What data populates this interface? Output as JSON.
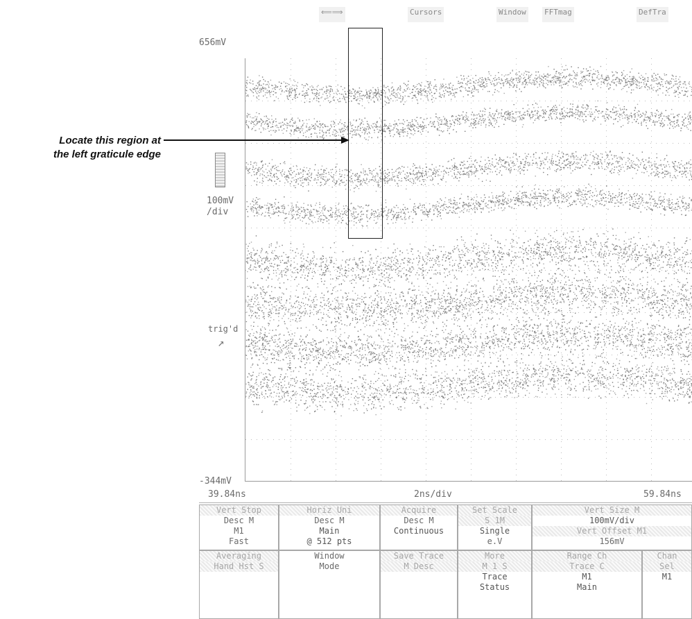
{
  "menu": {
    "items": [
      "⟸⟹",
      "Cursors",
      "Window",
      "FFTmag",
      "DefTra"
    ]
  },
  "scope": {
    "top_voltage": "656mV",
    "bottom_voltage": "-344mV",
    "volts_per_div": [
      "100mV",
      "/div"
    ],
    "trigger_label": "trig'd",
    "time_left": "39.84ns",
    "time_per_div": "2ns/div",
    "time_right": "59.84ns"
  },
  "callout": {
    "line1": "Locate this region at",
    "line2": "the left graticule edge"
  },
  "panel": {
    "cells": [
      {
        "rows": [
          "Vert Stop",
          "Desc M",
          "M1",
          "Fast"
        ]
      },
      {
        "rows": [
          "Horiz Uni",
          "Desc M",
          "Main",
          "@ 512 pts"
        ]
      },
      {
        "rows": [
          "Acquire",
          "Desc M",
          "Continuous",
          ""
        ]
      },
      {
        "rows": [
          "Set Scale",
          "S 1M",
          "Single",
          "e.V"
        ]
      },
      {
        "rows": [
          "Vert Size M",
          "100mV/div",
          "Vert Offset M1",
          "156mV"
        ]
      },
      {
        "rows": [
          "Averaging",
          "Hand Hst S",
          "",
          ""
        ]
      },
      {
        "rows": [
          "Window",
          "Mode",
          "",
          ""
        ]
      },
      {
        "rows": [
          "Save Trace",
          "M Desc",
          "",
          ""
        ]
      },
      {
        "rows": [
          "More",
          "M 1 S",
          "Trace",
          "Status"
        ]
      },
      {
        "rows": [
          "Range Ch",
          "Trace C",
          "M1",
          "Main"
        ]
      },
      {
        "rows": [
          "Chan",
          "Sel",
          "M1",
          ""
        ]
      }
    ]
  }
}
